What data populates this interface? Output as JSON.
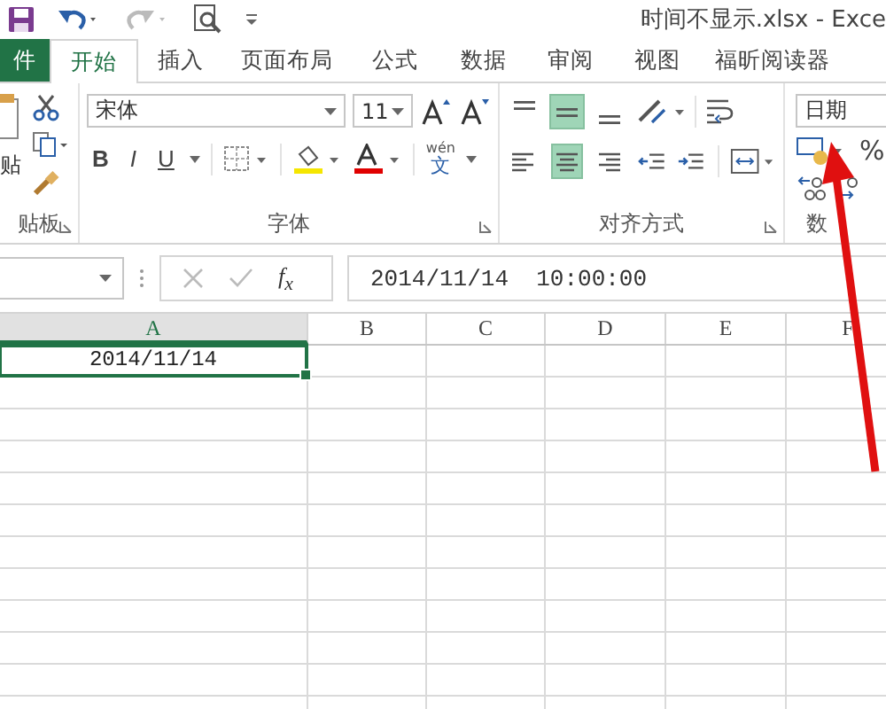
{
  "window": {
    "title": "时间不显示.xlsx - Exce"
  },
  "tabs": [
    {
      "label": "件",
      "kind": "file",
      "selected": false
    },
    {
      "label": "开始",
      "kind": "tab",
      "selected": true
    },
    {
      "label": "插入",
      "kind": "tab",
      "selected": false
    },
    {
      "label": "页面布局",
      "kind": "tab",
      "selected": false
    },
    {
      "label": "公式",
      "kind": "tab",
      "selected": false
    },
    {
      "label": "数据",
      "kind": "tab",
      "selected": false
    },
    {
      "label": "审阅",
      "kind": "tab",
      "selected": false
    },
    {
      "label": "视图",
      "kind": "tab",
      "selected": false
    },
    {
      "label": "福昕阅读器",
      "kind": "tab",
      "selected": false
    }
  ],
  "ribbon": {
    "clipboard": {
      "paste_label": "贴",
      "group_label": "贴板"
    },
    "font": {
      "name": "宋体",
      "size": "11",
      "bold": "B",
      "italic": "I",
      "underline": "U",
      "phonetic": "wén",
      "phonetic_char": "文",
      "group_label": "字体"
    },
    "alignment": {
      "vertical": [
        {
          "selected": false
        },
        {
          "selected": true
        },
        {
          "selected": false
        }
      ],
      "horizontal": [
        {
          "selected": false
        },
        {
          "selected": true
        },
        {
          "selected": false
        }
      ],
      "group_label": "对齐方式"
    },
    "number": {
      "format": "日期",
      "percent": "%",
      "group_label": "数"
    }
  },
  "formula_bar": {
    "fx": "f$_{x}$",
    "value": "2014/11/14  10:00:00"
  },
  "sheet": {
    "columns": [
      {
        "label": "A",
        "selected": true
      },
      {
        "label": "B",
        "selected": false
      },
      {
        "label": "C",
        "selected": false
      },
      {
        "label": "D",
        "selected": false
      },
      {
        "label": "E",
        "selected": false
      },
      {
        "label": "F",
        "selected": false
      }
    ],
    "active_cell": {
      "value": "2014/11/14"
    }
  }
}
